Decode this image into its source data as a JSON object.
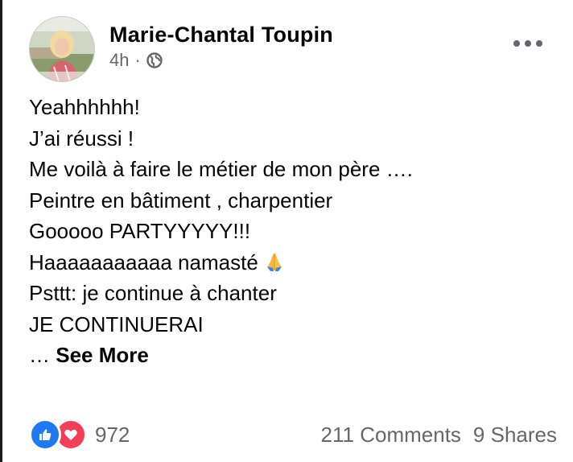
{
  "post": {
    "author": "Marie-Chantal Toupin",
    "time": "4h",
    "separator": "·",
    "privacy_icon": "globe-icon",
    "menu_icon": "more-horizontal-icon",
    "lines": [
      "Yeahhhhhh!",
      "J’ai réussi !",
      "Me voilà à faire le métier de mon père ….",
      "Peintre en bâtiment , charpentier",
      "Gooooo PARTYYYYY!!!",
      "Haaaaaaaaaaa namasté",
      "Psttt: je continue à chanter",
      "JE CONTINUERAI"
    ],
    "namaste_emoji": "🙏",
    "ellipsis": "…",
    "see_more": "See More"
  },
  "footer": {
    "reaction_icons": [
      "like-icon",
      "love-icon"
    ],
    "reaction_count": "972",
    "comments": "211 Comments",
    "shares": "9 Shares"
  },
  "colors": {
    "text": "#050505",
    "secondary": "#65676b",
    "like": "#2078f4",
    "love": "#f33e58"
  }
}
